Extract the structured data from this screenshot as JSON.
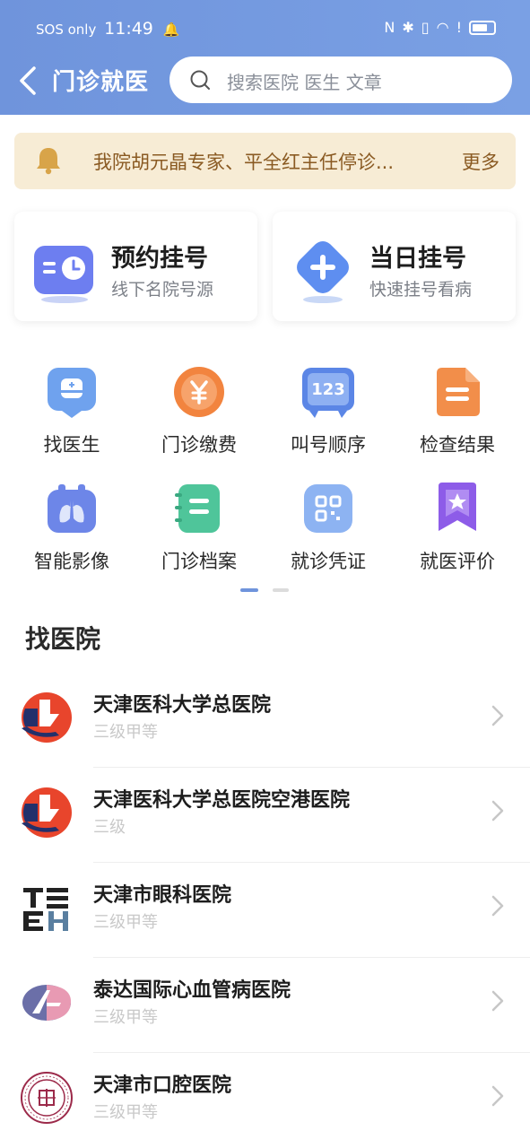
{
  "status_bar": {
    "carrier": "SOS only",
    "time": "11:49",
    "icons": [
      "bell-icon",
      "nfc-icon",
      "bluetooth-icon",
      "vibrate-icon",
      "wifi-icon",
      "alert-icon",
      "battery-icon"
    ]
  },
  "header": {
    "title": "门诊就医",
    "search_placeholder": "搜索医院 医生 文章",
    "bg_color": "#7399e0"
  },
  "notice": {
    "text": "我院胡元晶专家、平全红主任停诊...",
    "more": "更多"
  },
  "cards": [
    {
      "title": "预约挂号",
      "subtitle": "线下名院号源",
      "icon": "calendar-clock-icon"
    },
    {
      "title": "当日挂号",
      "subtitle": "快速挂号看病",
      "icon": "plus-diamond-icon"
    }
  ],
  "grid": [
    {
      "label": "找医生",
      "icon": "doctor-icon"
    },
    {
      "label": "门诊缴费",
      "icon": "yen-coin-icon"
    },
    {
      "label": "叫号顺序",
      "icon": "number-display-icon"
    },
    {
      "label": "检查结果",
      "icon": "report-icon"
    },
    {
      "label": "智能影像",
      "icon": "lungs-icon"
    },
    {
      "label": "门诊档案",
      "icon": "archive-icon"
    },
    {
      "label": "就诊凭证",
      "icon": "qr-code-icon"
    },
    {
      "label": "就医评价",
      "icon": "star-badge-icon"
    }
  ],
  "section_title": "找医院",
  "hospitals": [
    {
      "name": "天津医科大学总医院",
      "level": "三级甲等"
    },
    {
      "name": "天津医科大学总医院空港医院",
      "level": "三级"
    },
    {
      "name": "天津市眼科医院",
      "level": "三级甲等"
    },
    {
      "name": "泰达国际心血管病医院",
      "level": "三级甲等"
    },
    {
      "name": "天津市口腔医院",
      "level": "三级甲等"
    }
  ],
  "pager": {
    "current": 1,
    "total": 2
  }
}
